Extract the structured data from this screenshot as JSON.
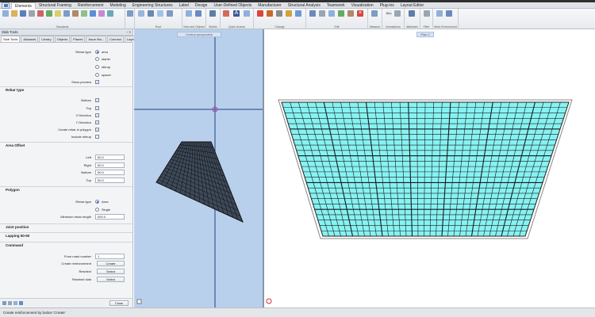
{
  "menu": [
    "Elements",
    "Structural Framing",
    "Reinforcement",
    "Modeling",
    "Engineering Structures",
    "Label",
    "Design",
    "User-Defined Objects",
    "Manufacturer",
    "Structural Analysis",
    "Teamwork",
    "Visualization",
    "Plug-ins",
    "Layout Editor"
  ],
  "menu_active_index": 0,
  "ribbon_groups": [
    "Standards",
    "Roof",
    "View and Objects",
    "Mobile",
    "Quick Access",
    "Change",
    "Edit",
    "Measure",
    "Annotations",
    "Attributes",
    "Filter",
    "Work Environment"
  ],
  "panel": {
    "title": "Slab Tools",
    "pin": "◦ ×",
    "tabs": [
      "Slab Tools",
      "Allwands",
      "Library",
      "Objects",
      "Planes",
      "Issue Ma...",
      "Connect",
      "Layers"
    ],
    "rebar_type_label": "Rebar type",
    "rebar_type_options": [
      "area",
      "starter",
      "stirrup",
      "spacer"
    ],
    "show_preview_label": "Show preview",
    "sections": {
      "rebar_type": "Rebar type",
      "area_offset": "Area Offset",
      "polygon": "Polygon",
      "joint_position": "Joint position",
      "lapping": "Lapping 50-50",
      "command": "Command"
    },
    "rebar_checks": [
      {
        "label": "Bottom",
        "checked": true
      },
      {
        "label": "Top",
        "checked": true
      },
      {
        "label": "X Direction",
        "checked": true
      },
      {
        "label": "Y Direction",
        "checked": true
      },
      {
        "label": "Create rebar in polygon",
        "checked": true
      },
      {
        "label": "Include stirrup",
        "checked": false
      }
    ],
    "offsets": [
      {
        "label": "Left",
        "value": "50.0"
      },
      {
        "label": "Right",
        "value": "50.0"
      },
      {
        "label": "Bottom",
        "value": "50.0"
      },
      {
        "label": "Top",
        "value": "50.0"
      }
    ],
    "polygon_rebar_type_label": "Rebar type",
    "polygon_options": [
      "Area",
      "Single"
    ],
    "min_rebar_length_label": "Minimum rebar length",
    "min_rebar_length_value": "500.0",
    "from_mark_label": "From mark number",
    "from_mark_value": "1",
    "create_reinforcement_label": "Create reinforcement",
    "create_button": "Create",
    "reselect_label": "Reselect",
    "reselect_slab_label": "Reselect slab",
    "select_button": "Select",
    "close_button": "Close"
  },
  "view3d": {
    "title": "Central perspective"
  },
  "plan": {
    "title": "Plan 2"
  },
  "status": {
    "text": "Create reinforcement by button 'Create'"
  },
  "colors": {
    "slab_fill": "#87f2f2",
    "view3d_bg": "#b9d0ec",
    "accent": "#2a5ad8"
  }
}
